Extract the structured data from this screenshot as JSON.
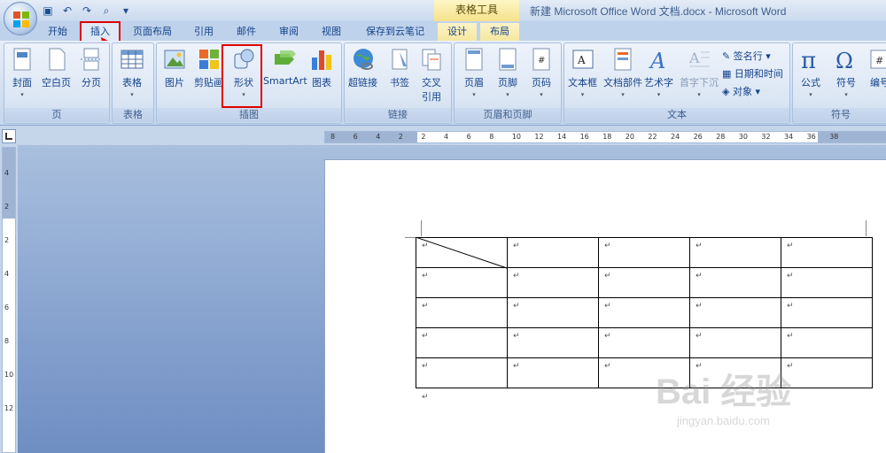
{
  "window": {
    "title": "新建 Microsoft Office Word 文档.docx - Microsoft Word",
    "context_tools_label": "表格工具"
  },
  "quick_access": {
    "save_icon": "save-icon",
    "undo_icon": "undo-icon",
    "redo_icon": "redo-icon",
    "print_preview_icon": "print-preview-icon",
    "customize_icon": "customize-icon"
  },
  "tabs": [
    {
      "label": "开始"
    },
    {
      "label": "插入"
    },
    {
      "label": "页面布局"
    },
    {
      "label": "引用"
    },
    {
      "label": "邮件"
    },
    {
      "label": "审阅"
    },
    {
      "label": "视图"
    },
    {
      "label": "保存到云笔记"
    },
    {
      "label": "设计"
    },
    {
      "label": "布局"
    }
  ],
  "ribbon": {
    "pages": {
      "label": "页",
      "cover": "封面",
      "blank": "空白页",
      "break": "分页"
    },
    "tables": {
      "label": "表格",
      "table": "表格"
    },
    "illustrations": {
      "label": "插图",
      "picture": "图片",
      "clipart": "剪贴画",
      "shapes": "形状",
      "smartart": "SmartArt",
      "chart": "图表"
    },
    "links": {
      "label": "链接",
      "hyperlink": "超链接",
      "bookmark": "书签",
      "crossref_line1": "交叉",
      "crossref_line2": "引用"
    },
    "header_footer": {
      "label": "页眉和页脚",
      "header": "页眉",
      "footer": "页脚",
      "page_number": "页码"
    },
    "text": {
      "label": "文本",
      "textbox": "文本框",
      "quickparts": "文档部件",
      "wordart": "艺术字",
      "dropcap": "首字下沉",
      "signature": "签名行",
      "datetime": "日期和时间",
      "object": "对象"
    },
    "symbols": {
      "label": "符号",
      "equation": "公式",
      "symbol": "符号",
      "number": "编号"
    }
  },
  "ruler": {
    "h_labels": [
      "8",
      "6",
      "4",
      "2",
      "2",
      "4",
      "6",
      "8",
      "10",
      "12",
      "14",
      "16",
      "18",
      "20",
      "22",
      "24",
      "26",
      "28",
      "30",
      "32",
      "34",
      "36",
      "38"
    ],
    "v_labels": [
      "4",
      "2",
      "2",
      "4",
      "6",
      "8",
      "10",
      "12"
    ]
  },
  "document": {
    "table_rows": 5,
    "table_cols": 5,
    "paragraph_mark": "↵"
  },
  "watermark": {
    "brand": "Bai  经验",
    "url": "jingyan.baidu.com"
  },
  "colors": {
    "highlight": "#e00000",
    "ribbon_text": "#15428b"
  }
}
